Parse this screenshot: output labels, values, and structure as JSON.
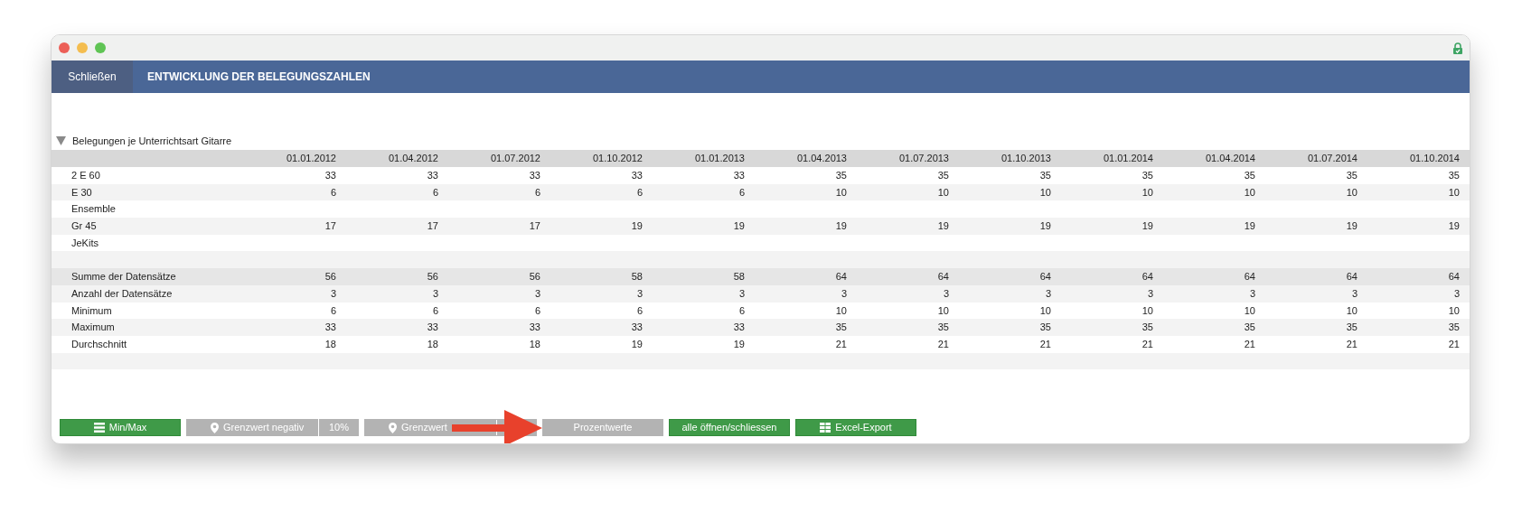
{
  "toolbar": {
    "close_button": "Schließen",
    "title": "ENTWICKLUNG DER BELEGUNGSZAHLEN"
  },
  "section": {
    "title": "Belegungen je Unterrichtsart Gitarre",
    "expanded": true
  },
  "table": {
    "columns": [
      "01.01.2012",
      "01.04.2012",
      "01.07.2012",
      "01.10.2012",
      "01.01.2013",
      "01.04.2013",
      "01.07.2013",
      "01.10.2013",
      "01.01.2014",
      "01.04.2014",
      "01.07.2014",
      "01.10.2014"
    ],
    "rows": [
      {
        "kind": "data",
        "label": "2 E 60",
        "values": [
          "33",
          "33",
          "33",
          "33",
          "33",
          "35",
          "35",
          "35",
          "35",
          "35",
          "35",
          "35"
        ]
      },
      {
        "kind": "data",
        "label": "E 30",
        "values": [
          "6",
          "6",
          "6",
          "6",
          "6",
          "10",
          "10",
          "10",
          "10",
          "10",
          "10",
          "10"
        ]
      },
      {
        "kind": "data",
        "label": "Ensemble"
      },
      {
        "kind": "data",
        "label": "Gr 45",
        "values": [
          "17",
          "17",
          "17",
          "19",
          "19",
          "19",
          "19",
          "19",
          "19",
          "19",
          "19",
          "19"
        ]
      },
      {
        "kind": "data",
        "label": "JeKits"
      },
      {
        "kind": "spacer"
      },
      {
        "kind": "sum",
        "label": "Summe der Datensätze",
        "values": [
          "56",
          "56",
          "56",
          "58",
          "58",
          "64",
          "64",
          "64",
          "64",
          "64",
          "64",
          "64"
        ]
      },
      {
        "kind": "data",
        "label": "Anzahl der Datensätze",
        "values": [
          "3",
          "3",
          "3",
          "3",
          "3",
          "3",
          "3",
          "3",
          "3",
          "3",
          "3",
          "3"
        ]
      },
      {
        "kind": "data",
        "label": "Minimum",
        "values": [
          "6",
          "6",
          "6",
          "6",
          "6",
          "10",
          "10",
          "10",
          "10",
          "10",
          "10",
          "10"
        ]
      },
      {
        "kind": "data",
        "label": "Maximum",
        "values": [
          "33",
          "33",
          "33",
          "33",
          "33",
          "35",
          "35",
          "35",
          "35",
          "35",
          "35",
          "35"
        ]
      },
      {
        "kind": "data",
        "label": "Durchschnitt",
        "values": [
          "18",
          "18",
          "18",
          "19",
          "19",
          "21",
          "21",
          "21",
          "21",
          "21",
          "21",
          "21"
        ]
      },
      {
        "kind": "spacer"
      }
    ]
  },
  "buttons": [
    {
      "kind": "menu",
      "label": "Min/Max",
      "on": true
    },
    {
      "kind": "pin",
      "label": "Grenzwert negativ",
      "value": "10%",
      "on": false
    },
    {
      "kind": "pin-split",
      "label": "Grenzwert",
      "on": false
    },
    {
      "kind": "plain",
      "label": "Prozentwerte",
      "on": false
    },
    {
      "kind": "plain",
      "label": "alle öffnen/schliessen",
      "on": true
    },
    {
      "kind": "grid",
      "label": "Excel-Export",
      "on": true
    }
  ],
  "annotation": {
    "kind": "arrow"
  }
}
